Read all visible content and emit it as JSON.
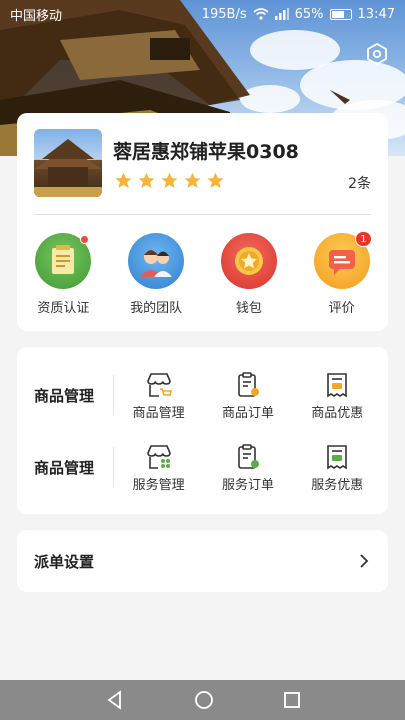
{
  "status_bar": {
    "carrier": "中国移动",
    "speed": "195B/s",
    "battery": "65%",
    "time": "13:47"
  },
  "profile": {
    "shop_name": "蓉居惠郑铺苹果0308",
    "rating_stars": 5,
    "review_count": "2条"
  },
  "shortcuts": [
    {
      "label": "资质认证",
      "icon": "certificate-icon",
      "color": "#5aae4a",
      "badge": "dot"
    },
    {
      "label": "我的团队",
      "icon": "team-icon",
      "color": "#3e8fd8",
      "badge": ""
    },
    {
      "label": "钱包",
      "icon": "wallet-icon",
      "color": "#e8443a",
      "badge": ""
    },
    {
      "label": "评价",
      "icon": "review-icon",
      "color": "#f5a623",
      "badge": "1"
    }
  ],
  "management": {
    "goods": {
      "title": "商品管理",
      "items": [
        {
          "label": "商品管理",
          "icon": "shop-icon"
        },
        {
          "label": "商品订单",
          "icon": "order-icon"
        },
        {
          "label": "商品优惠",
          "icon": "coupon-icon"
        }
      ]
    },
    "service": {
      "title": "商品管理",
      "items": [
        {
          "label": "服务管理",
          "icon": "service-shop-icon"
        },
        {
          "label": "服务订单",
          "icon": "service-order-icon"
        },
        {
          "label": "服务优惠",
          "icon": "service-coupon-icon"
        }
      ]
    }
  },
  "dispatch": {
    "label": "派单设置"
  },
  "colors": {
    "accent_orange": "#f5a623",
    "background": "#f4f4f4"
  }
}
